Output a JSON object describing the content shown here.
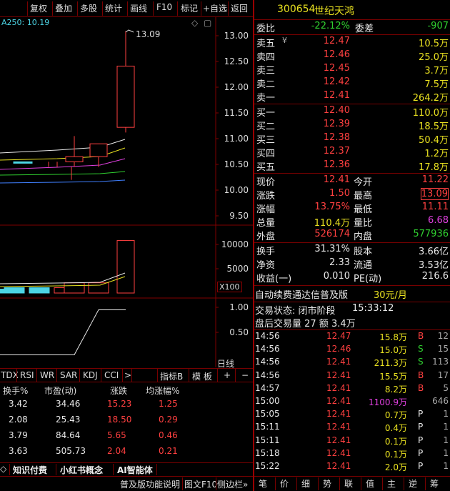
{
  "toolbar": {
    "items": [
      "复权",
      "叠加",
      "多股",
      "统计",
      "画线",
      "F10",
      "标记",
      "+自选",
      "返回"
    ]
  },
  "chart": {
    "ma_label": "A250: 10.19",
    "peak_label": "13.09",
    "price_axis": [
      "13.00",
      "12.50",
      "12.00",
      "11.50",
      "11.00",
      "10.50",
      "10.00",
      "9.50"
    ],
    "volume_axis": [
      "10000",
      "5000"
    ],
    "volume_unit": "X100",
    "ind_axis": [
      "1.00",
      "0.50"
    ],
    "period_label": "日线",
    "candles": [
      {
        "o": 10.55,
        "c": 10.55,
        "h": 10.55,
        "l": 10.55
      },
      {
        "o": 10.45,
        "c": 10.55,
        "h": 10.55,
        "l": 10.45
      },
      {
        "o": 10.45,
        "c": 10.55,
        "h": 10.55,
        "l": 10.45
      },
      {
        "o": 10.45,
        "c": 10.45,
        "h": 10.45,
        "l": 10.2
      },
      {
        "o": 10.55,
        "c": 10.65,
        "h": 11.05,
        "l": 10.45
      },
      {
        "o": 10.65,
        "c": 10.9,
        "h": 10.9,
        "l": 10.45
      },
      {
        "o": 11.22,
        "c": 12.41,
        "h": 13.09,
        "l": 11.12
      }
    ],
    "volumes": [
      800,
      1100,
      1100,
      1100,
      2100,
      2100,
      10800
    ],
    "indicator": [
      0.05,
      0.05,
      0.05,
      0.05,
      0.05,
      0.95,
      0.95
    ]
  },
  "ind_tabs": {
    "items": [
      "TDX",
      "RSI",
      "WR",
      "SAR",
      "KDJ",
      "CCI",
      ">"
    ],
    "right": [
      "指标B",
      "模 板",
      "+",
      "−"
    ]
  },
  "table": {
    "headers": [
      "换手%",
      "市盈(动)",
      "涨跌",
      "均涨幅%"
    ],
    "rows": [
      [
        "3.42",
        "34.46",
        "15.23",
        "1.25"
      ],
      [
        "2.08",
        "25.43",
        "18.50",
        "0.29"
      ],
      [
        "3.79",
        "84.64",
        "5.65",
        "0.46"
      ],
      [
        "3.63",
        "505.73",
        "2.04",
        "0.21"
      ]
    ]
  },
  "bottom_tabs": [
    "知识付费",
    "小红书概念",
    "AI智能体"
  ],
  "status_left": [
    "普及版功能说明",
    "图文F10",
    "侧边栏»"
  ],
  "stock": {
    "code": "300654",
    "name": "世纪天鸿"
  },
  "weibi": {
    "label": "委比",
    "value": "-22.12%",
    "label2": "委差",
    "value2": "-907"
  },
  "sell": [
    {
      "label": "卖五",
      "price": "12.47",
      "vol": "10.5万",
      "flag": "¥"
    },
    {
      "label": "卖四",
      "price": "12.46",
      "vol": "25.0万"
    },
    {
      "label": "卖三",
      "price": "12.45",
      "vol": "3.7万"
    },
    {
      "label": "卖二",
      "price": "12.42",
      "vol": "7.5万"
    },
    {
      "label": "卖一",
      "price": "12.41",
      "vol": "264.2万"
    }
  ],
  "buy": [
    {
      "label": "买一",
      "price": "12.40",
      "vol": "110.0万"
    },
    {
      "label": "买二",
      "price": "12.39",
      "vol": "18.5万"
    },
    {
      "label": "买三",
      "price": "12.38",
      "vol": "50.4万"
    },
    {
      "label": "买四",
      "price": "12.37",
      "vol": "1.2万"
    },
    {
      "label": "买五",
      "price": "12.36",
      "vol": "17.8万"
    }
  ],
  "quote": [
    {
      "l1": "现价",
      "v1": "12.41",
      "l2": "今开",
      "v2": "11.22"
    },
    {
      "l1": "涨跌",
      "v1": "1.50",
      "l2": "最高",
      "v2": "13.09"
    },
    {
      "l1": "涨幅",
      "v1": "13.75%",
      "l2": "最低",
      "v2": "11.11"
    },
    {
      "l1": "总量",
      "v1": "110.4万",
      "l2": "量比",
      "v2": "6.68"
    },
    {
      "l1": "外盘",
      "v1": "526174",
      "l2": "内盘",
      "v2": "577936"
    }
  ],
  "fund": [
    {
      "l1": "换手",
      "v1": "31.31%",
      "l2": "股本",
      "v2": "3.66亿"
    },
    {
      "l1": "净资",
      "v1": "2.33",
      "l2": "流通",
      "v2": "3.53亿"
    },
    {
      "l1": "收益(一)",
      "v1": "0.010",
      "l2": "PE(动)",
      "v2": "216.6"
    }
  ],
  "promo": {
    "text": "自动续费通达信普及版",
    "price": "30元/月"
  },
  "trade_status": {
    "text": "交易状态: 闭市阶段",
    "time": "15:33:12"
  },
  "after_hours": {
    "text": "盘后交易量 27 额 3.4万"
  },
  "ticks": [
    {
      "t": "14:56",
      "p": "12.47",
      "v": "15.8万",
      "d": "B",
      "n": "12"
    },
    {
      "t": "14:56",
      "p": "12.46",
      "v": "15.0万",
      "d": "S",
      "n": "15"
    },
    {
      "t": "14:56",
      "p": "12.41",
      "v": "211.3万",
      "d": "S",
      "n": "113"
    },
    {
      "t": "14:56",
      "p": "12.41",
      "v": "15.5万",
      "d": "B",
      "n": "17"
    },
    {
      "t": "14:57",
      "p": "12.41",
      "v": "8.2万",
      "d": "B",
      "n": "5"
    },
    {
      "t": "15:00",
      "p": "12.41",
      "v": "1100.9万",
      "d": "",
      "n": "646"
    },
    {
      "t": "15:05",
      "p": "12.41",
      "v": "0.7万",
      "d": "P",
      "n": "1"
    },
    {
      "t": "15:11",
      "p": "12.41",
      "v": "0.4万",
      "d": "P",
      "n": "1"
    },
    {
      "t": "15:11",
      "p": "12.41",
      "v": "0.1万",
      "d": "P",
      "n": "1"
    },
    {
      "t": "15:18",
      "p": "12.41",
      "v": "0.1万",
      "d": "P",
      "n": "1"
    },
    {
      "t": "15:22",
      "p": "12.41",
      "v": "2.0万",
      "d": "P",
      "n": "1"
    }
  ],
  "bottom_buttons": [
    "笔",
    "价",
    "细",
    "势",
    "联",
    "值",
    "主",
    "逆",
    "筹"
  ],
  "colors": {
    "up": "#ff4040",
    "down": "#30d030",
    "border": "#800000"
  }
}
